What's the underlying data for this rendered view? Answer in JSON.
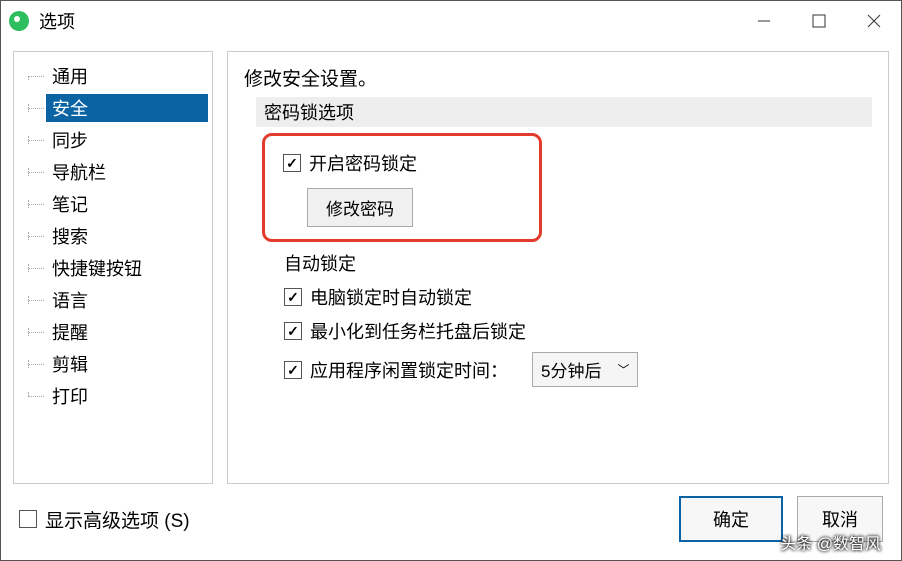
{
  "titlebar": {
    "title": "选项"
  },
  "sidebar": {
    "items": [
      {
        "label": "通用"
      },
      {
        "label": "安全",
        "selected": true
      },
      {
        "label": "同步"
      },
      {
        "label": "导航栏"
      },
      {
        "label": "笔记"
      },
      {
        "label": "搜索"
      },
      {
        "label": "快捷键按钮"
      },
      {
        "label": "语言"
      },
      {
        "label": "提醒"
      },
      {
        "label": "剪辑"
      },
      {
        "label": "打印"
      }
    ]
  },
  "content": {
    "heading": "修改安全设置。",
    "password_section": "密码锁选项",
    "enable_password_lock": "开启密码锁定",
    "change_password": "修改密码",
    "auto_lock_header": "自动锁定",
    "lock_on_pc_lock": "电脑锁定时自动锁定",
    "lock_on_minimize": "最小化到任务栏托盘后锁定",
    "idle_lock_label": "应用程序闲置锁定时间：",
    "idle_lock_value": "5分钟后"
  },
  "footer": {
    "show_advanced": "显示高级选项 (S)",
    "ok": "确定",
    "cancel": "取消"
  },
  "watermark": "头条 @数智风"
}
